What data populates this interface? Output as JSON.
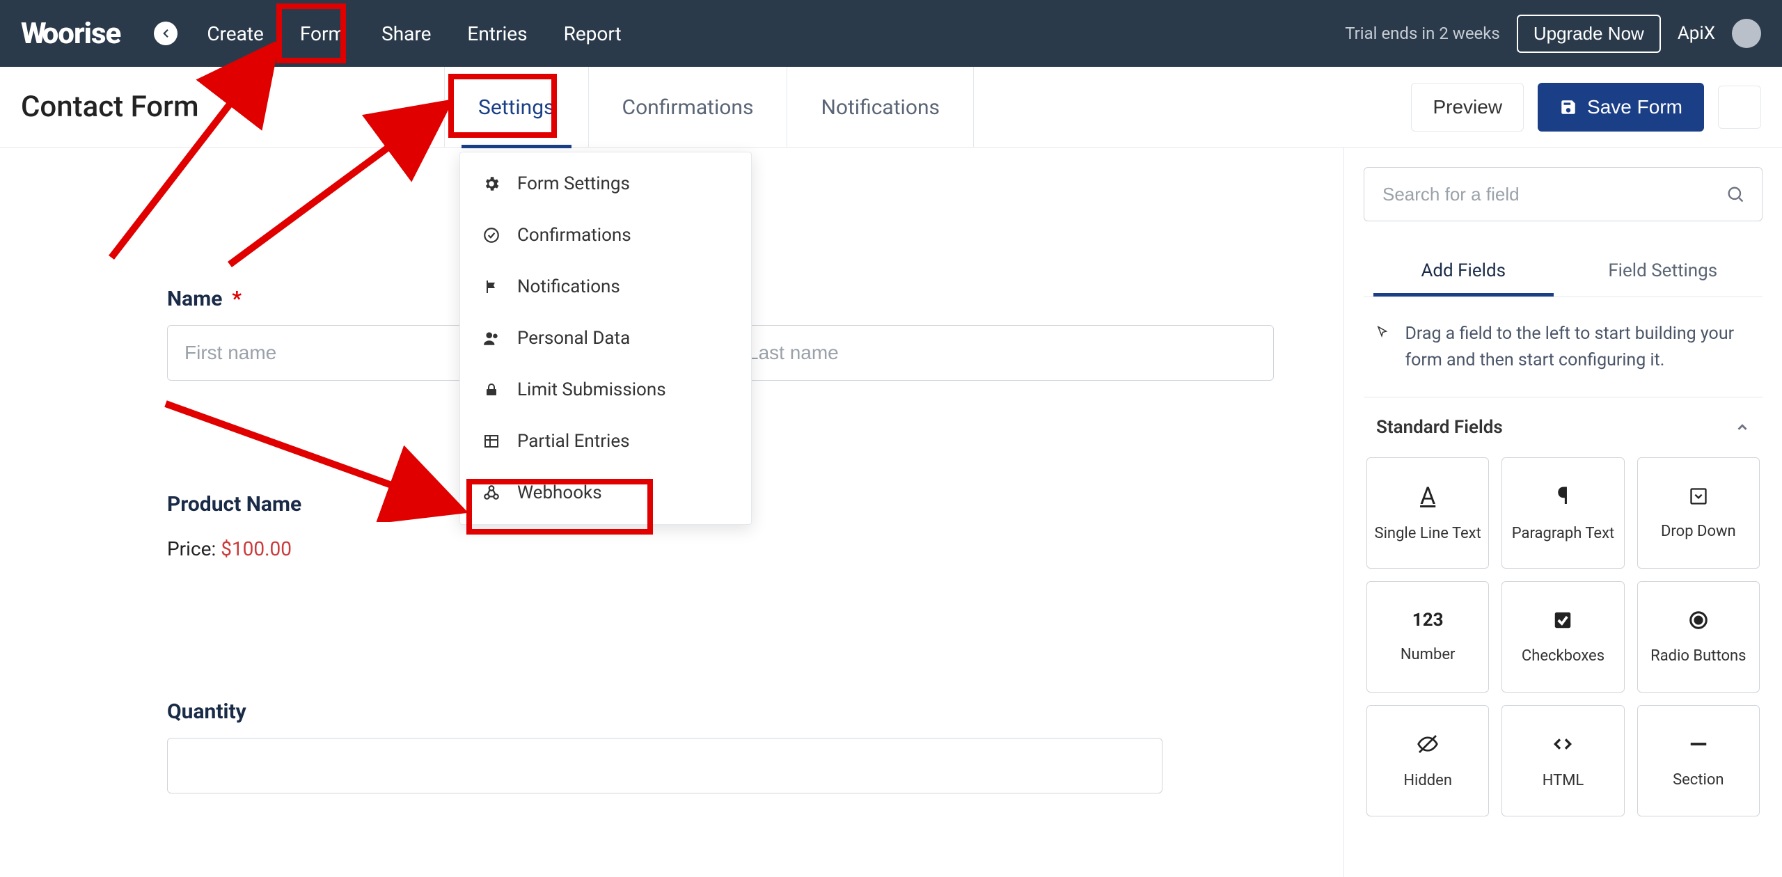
{
  "topbar": {
    "logo": "Woorise",
    "nav": [
      "Create",
      "Form",
      "Share",
      "Entries",
      "Report"
    ],
    "trial_text": "Trial ends in 2 weeks",
    "upgrade_label": "Upgrade Now",
    "user": "ApiX"
  },
  "secbar": {
    "title": "Contact Form",
    "tabs": [
      "Settings",
      "Confirmations",
      "Notifications"
    ],
    "preview_label": "Preview",
    "save_label": "Save Form"
  },
  "dropdown": {
    "items": [
      "Form Settings",
      "Confirmations",
      "Notifications",
      "Personal Data",
      "Limit Submissions",
      "Partial Entries",
      "Webhooks"
    ]
  },
  "canvas": {
    "name_label": "Name",
    "first_placeholder": "First name",
    "last_placeholder": "Last name",
    "product_label": "Product Name",
    "price_prefix": "Price: ",
    "price_value": "$100.00",
    "quantity_label": "Quantity"
  },
  "sidebar": {
    "search_placeholder": "Search for a field",
    "tabs": [
      "Add Fields",
      "Field Settings"
    ],
    "hint": "Drag a field to the left to start building your form and then start configuring it.",
    "section": "Standard Fields",
    "fields": [
      "Single Line Text",
      "Paragraph Text",
      "Drop Down",
      "Number",
      "Checkboxes",
      "Radio Buttons",
      "Hidden",
      "HTML",
      "Section"
    ]
  }
}
